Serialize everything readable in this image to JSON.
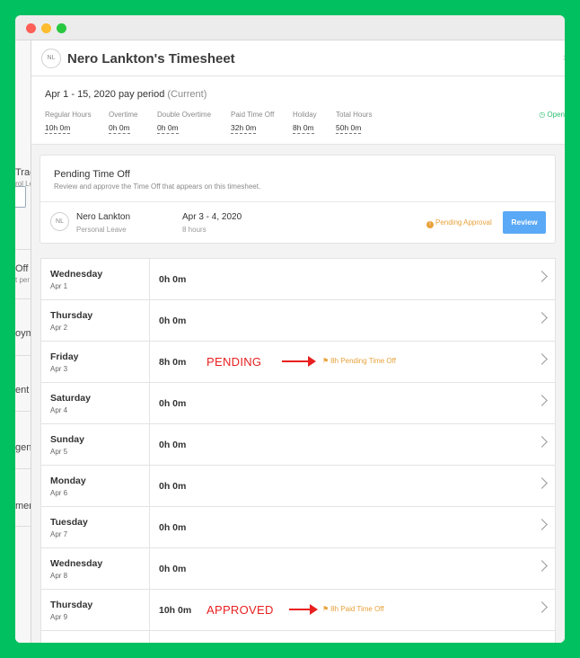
{
  "left_partial": [
    {
      "label": "Trac",
      "sub": "rol Le"
    },
    {
      "label": "Off",
      "sub": "t per"
    },
    {
      "label": "oym",
      "sub": ""
    },
    {
      "label": "ent",
      "sub": ""
    },
    {
      "label": "gen",
      "sub": ""
    },
    {
      "label": "men",
      "sub": ""
    }
  ],
  "header": {
    "avatar": "NL",
    "title": "Nero Lankton's Timesheet"
  },
  "period": {
    "title": "Apr 1 - 15, 2020 pay period",
    "current": "(Current)",
    "status": "Open",
    "stats": [
      {
        "label": "Regular Hours",
        "value": "10h 0m"
      },
      {
        "label": "Overtime",
        "value": "0h 0m"
      },
      {
        "label": "Double Overtime",
        "value": "0h 0m"
      },
      {
        "label": "Paid Time Off",
        "value": "32h 0m"
      },
      {
        "label": "Holiday",
        "value": "8h 0m"
      },
      {
        "label": "Total Hours",
        "value": "50h 0m"
      }
    ]
  },
  "pending": {
    "title": "Pending Time Off",
    "description": "Review and approve the Time Off that appears on this timesheet.",
    "avatar": "NL",
    "name": "Nero Lankton",
    "type": "Personal Leave",
    "dates": "Apr 3 - 4, 2020",
    "hours": "8 hours",
    "status": "Pending Approval",
    "status_icon": "!",
    "review_label": "Review"
  },
  "days": [
    {
      "day": "Wednesday",
      "date": "Apr 1",
      "hours": "0h 0m",
      "annotation": "",
      "tag": ""
    },
    {
      "day": "Thursday",
      "date": "Apr 2",
      "hours": "0h 0m",
      "annotation": "",
      "tag": ""
    },
    {
      "day": "Friday",
      "date": "Apr 3",
      "hours": "8h 0m",
      "annotation": "PENDING",
      "tag": "8h Pending Time Off"
    },
    {
      "day": "Saturday",
      "date": "Apr 4",
      "hours": "0h 0m",
      "annotation": "",
      "tag": ""
    },
    {
      "day": "Sunday",
      "date": "Apr 5",
      "hours": "0h 0m",
      "annotation": "",
      "tag": ""
    },
    {
      "day": "Monday",
      "date": "Apr 6",
      "hours": "0h 0m",
      "annotation": "",
      "tag": ""
    },
    {
      "day": "Tuesday",
      "date": "Apr 7",
      "hours": "0h 0m",
      "annotation": "",
      "tag": ""
    },
    {
      "day": "Wednesday",
      "date": "Apr 8",
      "hours": "0h 0m",
      "annotation": "",
      "tag": ""
    },
    {
      "day": "Thursday",
      "date": "Apr 9",
      "hours": "10h 0m",
      "annotation": "APPROVED",
      "tag": "8h Paid Time Off"
    }
  ],
  "colors": {
    "accent": "#5aa9f6",
    "warning": "#e8a13a",
    "open": "#2fbf71",
    "annotation": "#e82020",
    "background": "#00c060"
  }
}
